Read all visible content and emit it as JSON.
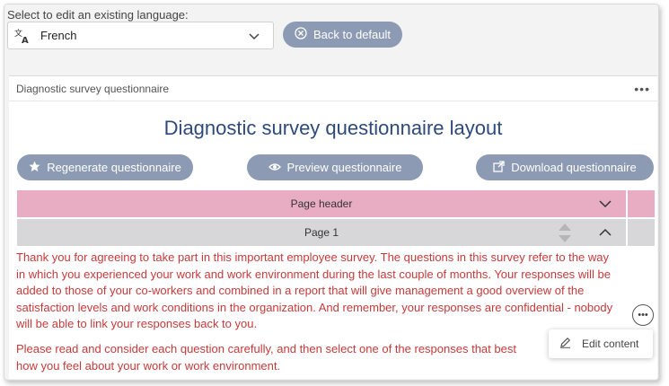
{
  "language_selector": {
    "label": "Select to edit an existing language:",
    "selected": "French",
    "icon": "language-icon"
  },
  "back_button": {
    "label": "Back to default",
    "icon": "close-circle-icon"
  },
  "panel": {
    "title": "Diagnostic survey questionnaire",
    "menu": "•••"
  },
  "layout_title": "Diagnostic survey questionnaire layout",
  "actions": {
    "regenerate": {
      "label": "Regenerate questionnaire",
      "icon": "star-icon"
    },
    "preview": {
      "label": "Preview questionnaire",
      "icon": "eye-icon"
    },
    "download": {
      "label": "Download questionnaire",
      "icon": "external-link-icon"
    }
  },
  "sections": {
    "page_header": "Page header",
    "page1": "Page 1"
  },
  "page1_text": {
    "paragraph1": "Thank you for agreeing to take part in this important employee survey. The questions in this survey refer to the way in which you experienced your work and work environment during the last couple of months. Your responses will be added to those of your co-workers and combined in a report that will give management a good overview of the satisfaction levels and work conditions in the organization. And remember, your responses are confidential - nobody will be able to link your responses back to you.",
    "paragraph2": "Please read and consider each question carefully, and then select one of the responses that best how you feel about your work or work environment."
  },
  "edit_popup": {
    "label": "Edit content",
    "icon": "pencil-icon",
    "more": "•••"
  },
  "colors": {
    "accent_button": "#8c9bb3",
    "page_header_bg": "#e8adc2",
    "page1_bg": "#d7d7d9",
    "title": "#2d4a7a",
    "body_text": "#c63a3a"
  }
}
